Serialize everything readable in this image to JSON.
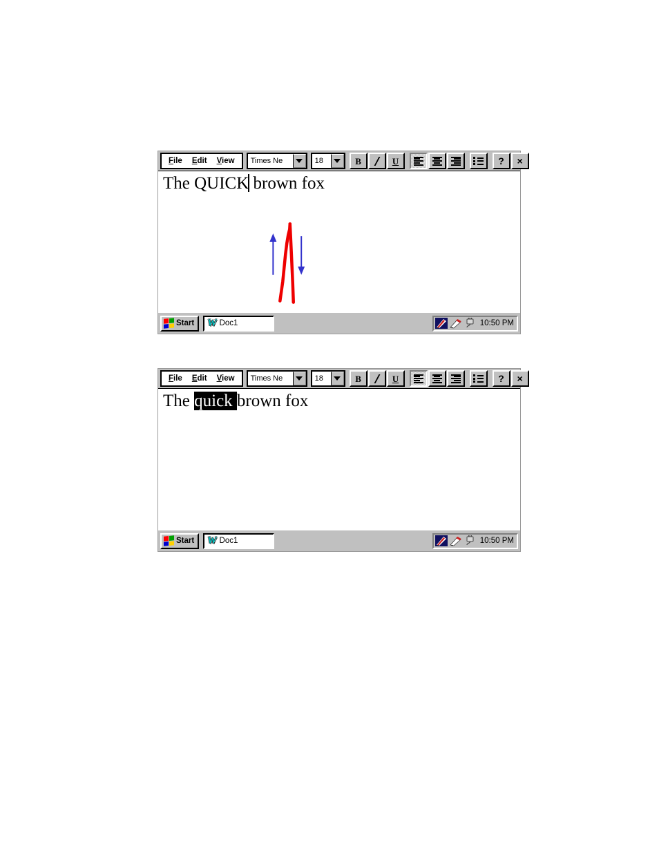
{
  "page": {
    "background": "#ffffff",
    "description": "Two Windows 95 style pen-computing application screenshots showing a gesture-based text edit: before (caret placed, up/down gesture drawn) and after (word selected)."
  },
  "toolbar": {
    "menus": [
      {
        "name": "file",
        "accel": "F",
        "rest": "ile",
        "label": "File"
      },
      {
        "name": "edit",
        "accel": "E",
        "rest": "dit",
        "label": "Edit"
      },
      {
        "name": "view",
        "accel": "V",
        "rest": "iew",
        "label": "View"
      }
    ],
    "font_combo": {
      "value": "Times Ne",
      "arrow_icon": "chevron-down-icon"
    },
    "size_combo": {
      "value": "18",
      "arrow_icon": "chevron-down-icon"
    },
    "buttons": [
      {
        "name": "bold-button",
        "icon": "bold-icon",
        "label": "B",
        "pressed": false
      },
      {
        "name": "italic-button",
        "icon": "italic-icon",
        "label": "I",
        "pressed": false
      },
      {
        "name": "underline-button",
        "icon": "underline-icon",
        "label": "U",
        "pressed": false
      },
      {
        "name": "align-left-button",
        "icon": "align-left-icon",
        "label": "",
        "pressed": true
      },
      {
        "name": "align-center-button",
        "icon": "align-center-icon",
        "label": "",
        "pressed": false
      },
      {
        "name": "align-right-button",
        "icon": "align-right-icon",
        "label": "",
        "pressed": false
      },
      {
        "name": "bullet-list-button",
        "icon": "bullet-list-icon",
        "label": "",
        "pressed": false
      },
      {
        "name": "help-button",
        "icon": "question-mark-icon",
        "label": "?",
        "pressed": false
      },
      {
        "name": "close-button",
        "icon": "close-icon",
        "label": "×",
        "pressed": false
      }
    ]
  },
  "window_before": {
    "document": {
      "text_before": "The ",
      "text_word": "QUICK",
      "text_after": " brown fox",
      "caret_after_word": true,
      "full_text": "The QUICK brown fox"
    },
    "gesture": {
      "stroke_color": "#ee0000",
      "arrow_color": "#3333cc",
      "shape": "caret-insertion-stroke",
      "left_arrow": "arrow-up",
      "right_arrow": "arrow-down"
    }
  },
  "window_after": {
    "document": {
      "text_before": "The ",
      "selected_text": "quick ",
      "text_after": "brown fox",
      "selection_background": "#000000",
      "selection_color": "#ffffff",
      "full_text": "The quick brown fox"
    }
  },
  "taskbar": {
    "start_label": "Start",
    "start_icon": "windows-flag-icon",
    "task_button": {
      "icon": "word-document-icon",
      "label": "Doc1"
    },
    "tray_icons": [
      "pen-tablet-icon",
      "stylus-pen-icon",
      "power-plug-icon"
    ],
    "clock": "10:50 PM"
  }
}
